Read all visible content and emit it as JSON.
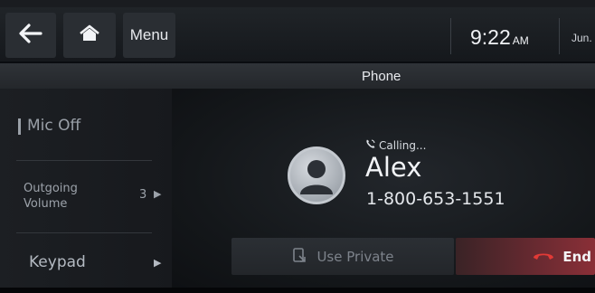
{
  "topbar": {
    "menu_label": "Menu",
    "time": "9:22",
    "ampm": "AM",
    "date": "Jun."
  },
  "title": "Phone",
  "side_menu": {
    "mic_off": "Mic Off",
    "outgoing_volume": "Outgoing Volume",
    "outgoing_volume_value": "3",
    "keypad": "Keypad"
  },
  "call": {
    "status": "Calling...",
    "contact_name": "Alex",
    "phone_number": "1-800-653-1551"
  },
  "actions": {
    "use_private": "Use Private",
    "end": "End"
  },
  "icons": {
    "back": "back-arrow-icon",
    "home": "home-icon",
    "calling": "phone-calling-icon",
    "avatar": "contact-avatar-icon",
    "private": "handset-private-icon",
    "end": "end-call-icon"
  },
  "colors": {
    "end_accent": "#c8302f",
    "text_primary": "#f2f4f7",
    "text_muted": "#9aa0a8"
  }
}
